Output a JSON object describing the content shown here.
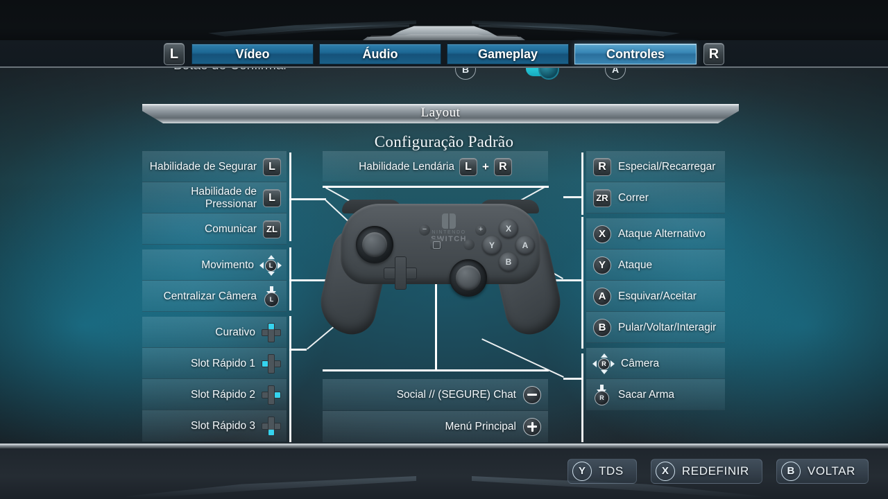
{
  "header": {
    "crest_icon": "ornament-crest",
    "shoulder_left": "L",
    "shoulder_right": "R",
    "tabs": [
      {
        "label": "Vídeo",
        "active": false
      },
      {
        "label": "Áudio",
        "active": false
      },
      {
        "label": "Gameplay",
        "active": false
      },
      {
        "label": "Controles",
        "active": true
      }
    ]
  },
  "scrolled_row": {
    "label": "Botão de Confirmar",
    "option_b": "B",
    "option_a": "A"
  },
  "section": {
    "banner_title": "Layout",
    "subtitle": "Configuração Padrão"
  },
  "center": {
    "top_row": {
      "label": "Habilidade Lendária",
      "button_1": "L",
      "plus": "+",
      "button_2": "R"
    },
    "bottom_rows": [
      {
        "label": "Social // (SEGURE) Chat",
        "icon": "minus-button"
      },
      {
        "label": "Menú Principal",
        "icon": "plus-button"
      }
    ]
  },
  "left_column": [
    {
      "label": "Habilidade de Segurar",
      "icon": "button-l",
      "glyph": "L",
      "type": "square",
      "group": 0
    },
    {
      "label": "Habilidade de Pressionar",
      "icon": "button-l",
      "glyph": "L",
      "type": "square",
      "group": 0
    },
    {
      "label": "Comunicar",
      "icon": "button-zl",
      "glyph": "ZL",
      "type": "square",
      "group": 0
    },
    {
      "label": "Movimento",
      "icon": "left-stick-move",
      "glyph": "L",
      "type": "stick",
      "group": 1
    },
    {
      "label": "Centralizar Câmera",
      "icon": "left-stick-press",
      "glyph": "L",
      "type": "stickpress",
      "group": 1
    },
    {
      "label": "Curativo",
      "icon": "dpad-up",
      "dir": "up",
      "type": "dpad",
      "group": 2
    },
    {
      "label": "Slot Rápido 1",
      "icon": "dpad-left",
      "dir": "left",
      "type": "dpad",
      "group": 2
    },
    {
      "label": "Slot Rápido 2",
      "icon": "dpad-right",
      "dir": "right",
      "type": "dpad",
      "group": 2
    },
    {
      "label": "Slot Rápido 3",
      "icon": "dpad-down",
      "dir": "down",
      "type": "dpad",
      "group": 2
    }
  ],
  "right_column": [
    {
      "label": "Especial/Recarregar",
      "icon": "button-r",
      "glyph": "R",
      "type": "square",
      "group": 0
    },
    {
      "label": "Correr",
      "icon": "button-zr",
      "glyph": "ZR",
      "type": "square",
      "group": 0
    },
    {
      "label": "Ataque Alternativo",
      "icon": "button-x",
      "glyph": "X",
      "type": "circle",
      "group": 1
    },
    {
      "label": "Ataque",
      "icon": "button-y",
      "glyph": "Y",
      "type": "circle",
      "group": 1
    },
    {
      "label": "Esquivar/Aceitar",
      "icon": "button-a",
      "glyph": "A",
      "type": "circle",
      "group": 1
    },
    {
      "label": "Pular/Voltar/Interagir",
      "icon": "button-b",
      "glyph": "B",
      "type": "circle",
      "group": 1
    },
    {
      "label": "Câmera",
      "icon": "right-stick-move",
      "glyph": "R",
      "type": "stick",
      "group": 2
    },
    {
      "label": "Sacar Arma",
      "icon": "right-stick-press",
      "glyph": "R",
      "type": "stickpress",
      "group": 2
    }
  ],
  "controller": {
    "brand_line1": "NINTENDO",
    "brand_line2": "SWITCH",
    "face_x": "X",
    "face_y": "Y",
    "face_a": "A",
    "face_b": "B",
    "minus": "−",
    "plus": "+",
    "home": "⌂"
  },
  "footer": {
    "actions": [
      {
        "glyph": "Y",
        "label": "TDS"
      },
      {
        "glyph": "X",
        "label": "REDEFINIR"
      },
      {
        "glyph": "B",
        "label": "VOLTAR"
      }
    ]
  },
  "colors": {
    "accent_blue": "#3886b5",
    "tab_blue": "#1d6794",
    "rail_white": "#ffffff",
    "panel_teal": "#1d4954"
  }
}
